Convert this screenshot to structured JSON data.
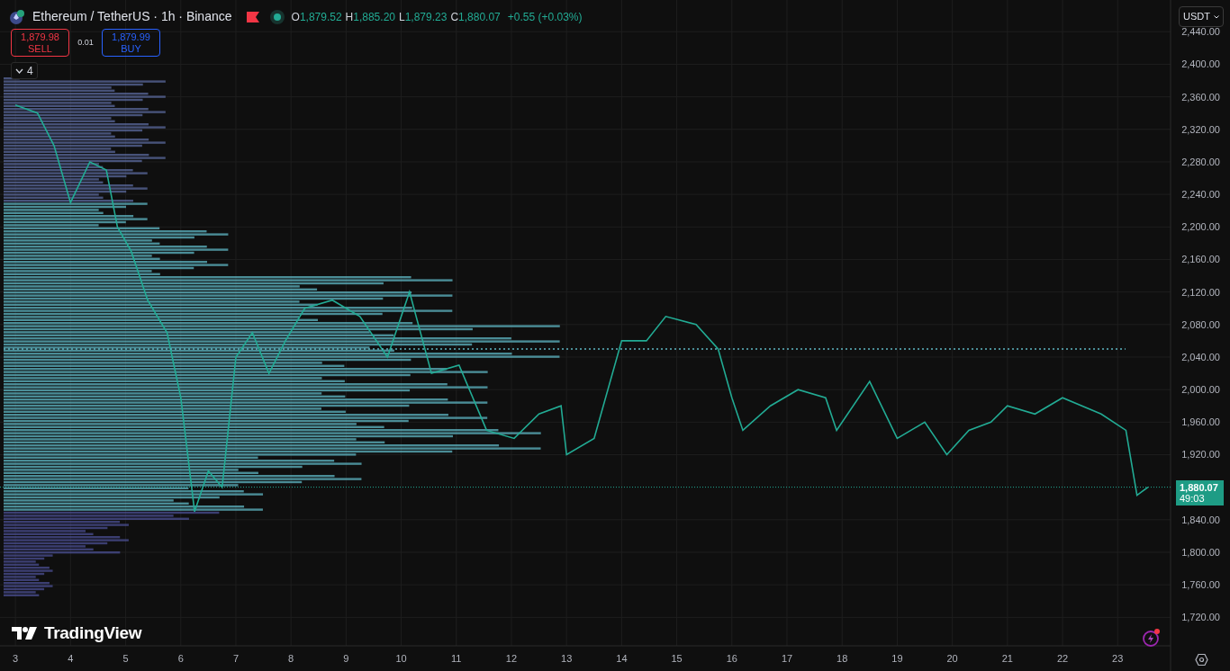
{
  "legend": {
    "title": "Ethereum / TetherUS · 1h · Binance",
    "ohlc": [
      {
        "label": "O",
        "value": "1,879.52"
      },
      {
        "label": "H",
        "value": "1,885.20"
      },
      {
        "label": "L",
        "value": "1,879.23"
      },
      {
        "label": "C",
        "value": "1,880.07"
      }
    ],
    "change": "+0.55 (+0.03%)"
  },
  "trade": {
    "sell_price": "1,879.98",
    "sell_label": "SELL",
    "spread": "0.01",
    "buy_price": "1,879.99",
    "buy_label": "BUY"
  },
  "indicators_toggle": {
    "count": "4",
    "expanded": false
  },
  "currency": "USDT",
  "last_price": {
    "value": "1,880.07",
    "countdown": "49:03"
  },
  "brand": "TradingView",
  "chart_data": {
    "type": "line",
    "x": [
      3.0,
      3.4,
      3.7,
      4.0,
      4.35,
      4.65,
      4.85,
      5.1,
      5.4,
      5.75,
      6.0,
      6.25,
      6.5,
      6.75,
      7.0,
      7.3,
      7.6,
      7.9,
      8.25,
      8.75,
      9.25,
      9.75,
      10.15,
      10.55,
      11.05,
      11.55,
      12.05,
      12.5,
      12.9,
      13.0,
      13.5,
      14.0,
      14.45,
      14.8,
      15.35,
      15.75,
      16.0,
      16.2,
      16.7,
      17.2,
      17.7,
      17.9,
      18.5,
      19.0,
      19.5,
      19.9,
      20.3,
      20.7,
      21.0,
      21.5,
      22.0,
      22.7,
      23.15,
      23.35,
      23.55
    ],
    "xlim": [
      2.72,
      23.96
    ],
    "ylim": [
      1685,
      2479
    ],
    "grid": true,
    "series": [
      {
        "color": "#22ab94",
        "values": [
          2350,
          2340,
          2300,
          2230,
          2280,
          2270,
          2200,
          2170,
          2110,
          2070,
          1990,
          1850,
          1900,
          1880,
          2040,
          2070,
          2020,
          2060,
          2100,
          2110,
          2090,
          2040,
          2120,
          2020,
          2030,
          1950,
          1940,
          1970,
          1980,
          1920,
          1940,
          2060,
          2060,
          2090,
          2080,
          2050,
          1990,
          1950,
          1980,
          2000,
          1990,
          1950,
          2010,
          1940,
          1960,
          1920,
          1950,
          1960,
          1980,
          1970,
          1990,
          1970,
          1950,
          1870,
          1880
        ]
      }
    ],
    "xticks": [
      3,
      4,
      5,
      6,
      7,
      8,
      9,
      10,
      11,
      12,
      13,
      14,
      15,
      16,
      17,
      18,
      19,
      20,
      21,
      22,
      23
    ],
    "yticks": [
      {
        "value": 2440,
        "label": "2,440.00"
      },
      {
        "value": 2400,
        "label": "2,400.00"
      },
      {
        "value": 2360,
        "label": "2,360.00"
      },
      {
        "value": 2320,
        "label": "2,320.00"
      },
      {
        "value": 2280,
        "label": "2,280.00"
      },
      {
        "value": 2240,
        "label": "2,240.00"
      },
      {
        "value": 2200,
        "label": "2,200.00"
      },
      {
        "value": 2160,
        "label": "2,160.00"
      },
      {
        "value": 2120,
        "label": "2,120.00"
      },
      {
        "value": 2080,
        "label": "2,080.00"
      },
      {
        "value": 2040,
        "label": "2,040.00"
      },
      {
        "value": 2000,
        "label": "2,000.00"
      },
      {
        "value": 1960,
        "label": "1,960.00"
      },
      {
        "value": 1920,
        "label": "1,920.00"
      },
      {
        "value": 1840,
        "label": "1,840.00"
      },
      {
        "value": 1800,
        "label": "1,800.00"
      },
      {
        "value": 1760,
        "label": "1,760.00"
      },
      {
        "value": 1720,
        "label": "1,720.00"
      }
    ]
  }
}
